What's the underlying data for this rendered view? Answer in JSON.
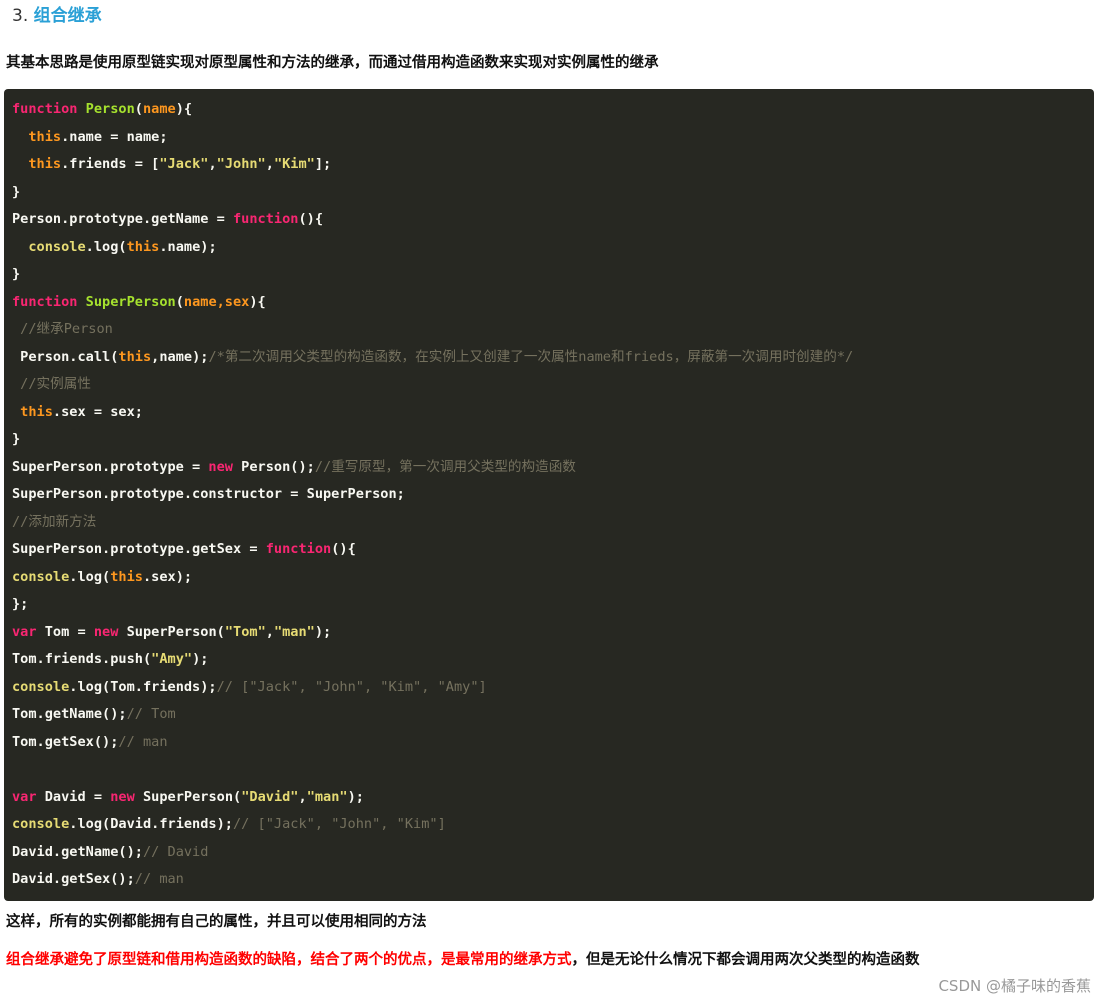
{
  "heading": {
    "number": "3.",
    "title": "组合继承"
  },
  "intro": "其基本思路是使用原型链实现对原型属性和方法的继承，而通过借用构造函数来实现对实例属性的继承",
  "code_lines": [
    [
      [
        "kw",
        "function "
      ],
      [
        "fn",
        "Person"
      ],
      [
        "",
        "("
      ],
      [
        "pm",
        "name"
      ],
      [
        "",
        "){"
      ]
    ],
    [
      [
        "",
        "  "
      ],
      [
        "th",
        "this"
      ],
      [
        "",
        ".name = name;"
      ]
    ],
    [
      [
        "",
        "  "
      ],
      [
        "th",
        "this"
      ],
      [
        "",
        ".friends = ["
      ],
      [
        "str",
        "\"Jack\""
      ],
      [
        "",
        ","
      ],
      [
        "str",
        "\"John\""
      ],
      [
        "",
        ","
      ],
      [
        "str",
        "\"Kim\""
      ],
      [
        "",
        "];"
      ]
    ],
    [
      [
        "",
        "}"
      ]
    ],
    [
      [
        "",
        "Person.prototype.getName = "
      ],
      [
        "kw",
        "function"
      ],
      [
        "",
        "(){"
      ]
    ],
    [
      [
        "",
        "  "
      ],
      [
        "bi",
        "console"
      ],
      [
        "",
        ".log("
      ],
      [
        "th",
        "this"
      ],
      [
        "",
        ".name);"
      ]
    ],
    [
      [
        "",
        "}"
      ]
    ],
    [
      [
        "kw",
        "function "
      ],
      [
        "fn",
        "SuperPerson"
      ],
      [
        "",
        "("
      ],
      [
        "pm",
        "name,sex"
      ],
      [
        "",
        "){"
      ]
    ],
    [
      [
        "cm",
        " //继承Person"
      ]
    ],
    [
      [
        "",
        " Person.call("
      ],
      [
        "th",
        "this"
      ],
      [
        "",
        ",name);"
      ],
      [
        "cm",
        "/*第二次调用父类型的构造函数，在实例上又创建了一次属性name和frieds，屏蔽第一次调用时创建的*/"
      ]
    ],
    [
      [
        "cm",
        " //实例属性"
      ]
    ],
    [
      [
        "",
        ""
      ],
      [
        "th",
        " this"
      ],
      [
        "",
        ".sex = sex;"
      ]
    ],
    [
      [
        "",
        "}"
      ]
    ],
    [
      [
        "",
        "SuperPerson.prototype = "
      ],
      [
        "kw",
        "new"
      ],
      [
        "",
        " Person();"
      ],
      [
        "cm",
        "//重写原型，第一次调用父类型的构造函数"
      ]
    ],
    [
      [
        "",
        "SuperPerson.prototype.constructor = SuperPerson;"
      ]
    ],
    [
      [
        "cm",
        "//添加新方法"
      ]
    ],
    [
      [
        "",
        "SuperPerson.prototype.getSex = "
      ],
      [
        "kw",
        "function"
      ],
      [
        "",
        "(){"
      ]
    ],
    [
      [
        "bi",
        "console"
      ],
      [
        "",
        ".log("
      ],
      [
        "th",
        "this"
      ],
      [
        "",
        ".sex);"
      ]
    ],
    [
      [
        "",
        "};"
      ]
    ],
    [
      [
        "kw",
        "var"
      ],
      [
        "",
        " Tom = "
      ],
      [
        "kw",
        "new"
      ],
      [
        "",
        " SuperPerson("
      ],
      [
        "str",
        "\"Tom\""
      ],
      [
        "",
        ","
      ],
      [
        "str",
        "\"man\""
      ],
      [
        "",
        ");"
      ]
    ],
    [
      [
        "",
        "Tom.friends.push("
      ],
      [
        "str",
        "\"Amy\""
      ],
      [
        "",
        ");"
      ]
    ],
    [
      [
        "bi",
        "console"
      ],
      [
        "",
        ".log(Tom.friends);"
      ],
      [
        "cm",
        "// [\"Jack\", \"John\", \"Kim\", \"Amy\"]"
      ]
    ],
    [
      [
        "",
        "Tom.getName();"
      ],
      [
        "cm",
        "// Tom"
      ]
    ],
    [
      [
        "",
        "Tom.getSex();"
      ],
      [
        "cm",
        "// man"
      ]
    ],
    [
      [
        "",
        ""
      ]
    ],
    [
      [
        "kw",
        "var"
      ],
      [
        "",
        " David = "
      ],
      [
        "kw",
        "new"
      ],
      [
        "",
        " SuperPerson("
      ],
      [
        "str",
        "\"David\""
      ],
      [
        "",
        ","
      ],
      [
        "str",
        "\"man\""
      ],
      [
        "",
        ");"
      ]
    ],
    [
      [
        "bi",
        "console"
      ],
      [
        "",
        ".log(David.friends);"
      ],
      [
        "cm",
        "// [\"Jack\", \"John\", \"Kim\"]"
      ]
    ],
    [
      [
        "",
        "David.getName();"
      ],
      [
        "cm",
        "// David"
      ]
    ],
    [
      [
        "",
        "David.getSex();"
      ],
      [
        "cm",
        "// man"
      ]
    ]
  ],
  "para1": "这样，所有的实例都能拥有自己的属性，并且可以使用相同的方法",
  "para2_red": "组合继承避免了原型链和借用构造函数的缺陷，结合了两个的优点，是最常用的继承方式",
  "para2_rest": "，但是无论什么情况下都会调用两次父类型的构造函数",
  "watermark": "CSDN @橘子味的香蕉"
}
